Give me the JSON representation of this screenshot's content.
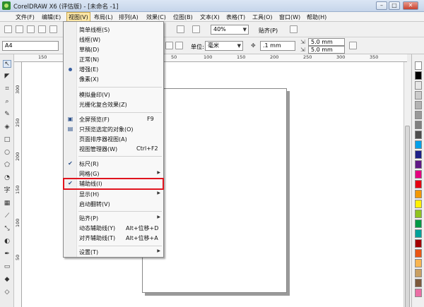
{
  "window": {
    "title": "CorelDRAW X6 (评估版) - [未命名 -1]"
  },
  "menubar": {
    "items": [
      "文件(F)",
      "编辑(E)",
      "视图(V)",
      "布局(L)",
      "排列(A)",
      "效果(C)",
      "位图(B)",
      "文本(X)",
      "表格(T)",
      "工具(O)",
      "窗口(W)",
      "帮助(H)"
    ]
  },
  "toolbar": {
    "zoom": "40%",
    "snap": "贴齐(P)"
  },
  "propbar": {
    "paper": "A4",
    "units_label": "单位:",
    "units_value": "毫米",
    "nudge": ".1 mm",
    "dup_x": "5.0 mm",
    "dup_y": "5.0 mm"
  },
  "rulers": {
    "h_ticks": [
      "150",
      "100",
      "50",
      "0",
      "50",
      "100",
      "150",
      "200",
      "250",
      "300",
      "350"
    ],
    "v_ticks": [
      "300",
      "250",
      "200",
      "150",
      "100",
      "50"
    ]
  },
  "view_menu": {
    "items": [
      {
        "label": "简单线框(S)"
      },
      {
        "label": "线框(W)"
      },
      {
        "label": "草稿(D)"
      },
      {
        "label": "正常(N)"
      },
      {
        "label": "增强(E)"
      },
      {
        "label": "像素(X)"
      },
      {
        "label": "模拟叠印(V)"
      },
      {
        "label": "光栅化复合效果(Z)"
      },
      {
        "label": "全屏预览(F)",
        "shortcut": "F9"
      },
      {
        "label": "只预览选定的对象(O)"
      },
      {
        "label": "页面排序器视图(A)"
      },
      {
        "label": "视图管理器(W)",
        "shortcut": "Ctrl+F2"
      },
      {
        "label": "标尺(R)"
      },
      {
        "label": "网格(G)"
      },
      {
        "label": "辅助线(I)"
      },
      {
        "label": "显示(H)"
      },
      {
        "label": "启动翻转(V)"
      },
      {
        "label": "贴齐(P)"
      },
      {
        "label": "动态辅助线(Y)",
        "shortcut": "Alt+位移+D"
      },
      {
        "label": "对齐辅助线(T)",
        "shortcut": "Alt+位移+A"
      },
      {
        "label": "设置(T)"
      }
    ]
  },
  "colors": {
    "accent_highlight": "#e0141e",
    "palette": [
      "#ffffff",
      "#000000",
      "#e6e6e6",
      "#cccccc",
      "#b3b3b3",
      "#999999",
      "#808080",
      "#4d4d4d",
      "#00a0e9",
      "#1d2088",
      "#601986",
      "#e4007f",
      "#e60012",
      "#f39800",
      "#fff100",
      "#8fc31f",
      "#009944",
      "#00a29a",
      "#a40000",
      "#ea5514",
      "#f8b551",
      "#c9a063",
      "#7d5a3c",
      "#eb6ea5"
    ]
  }
}
